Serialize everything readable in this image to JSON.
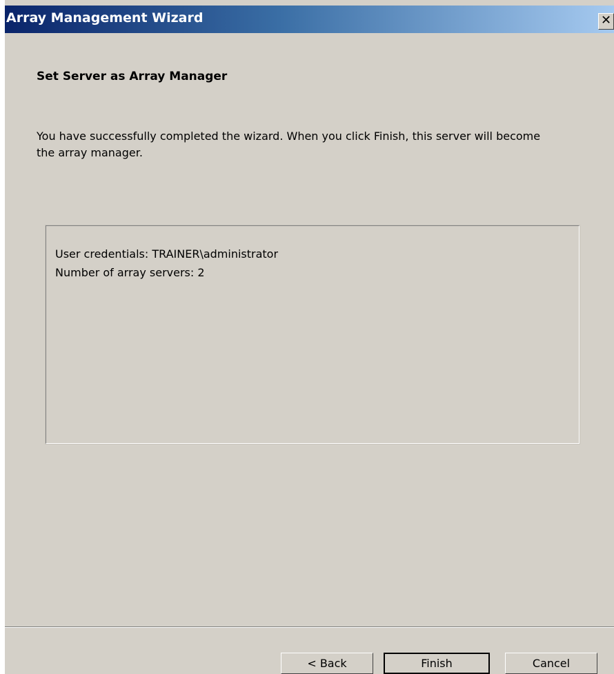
{
  "window": {
    "title": "Array Management Wizard",
    "close_glyph": "✕"
  },
  "page": {
    "heading": "Set Server as Array Manager",
    "description": "You have successfully completed the wizard. When you click Finish, this server will become the array manager."
  },
  "summary": {
    "lines": [
      "User credentials: TRAINER\\administrator",
      "Number of array servers: 2"
    ]
  },
  "buttons": {
    "back": "< Back",
    "finish": "Finish",
    "cancel": "Cancel"
  },
  "colors": {
    "dialog_background": "#d4d0c8",
    "titlebar_start": "#0a246a",
    "titlebar_end": "#a6caf0"
  }
}
